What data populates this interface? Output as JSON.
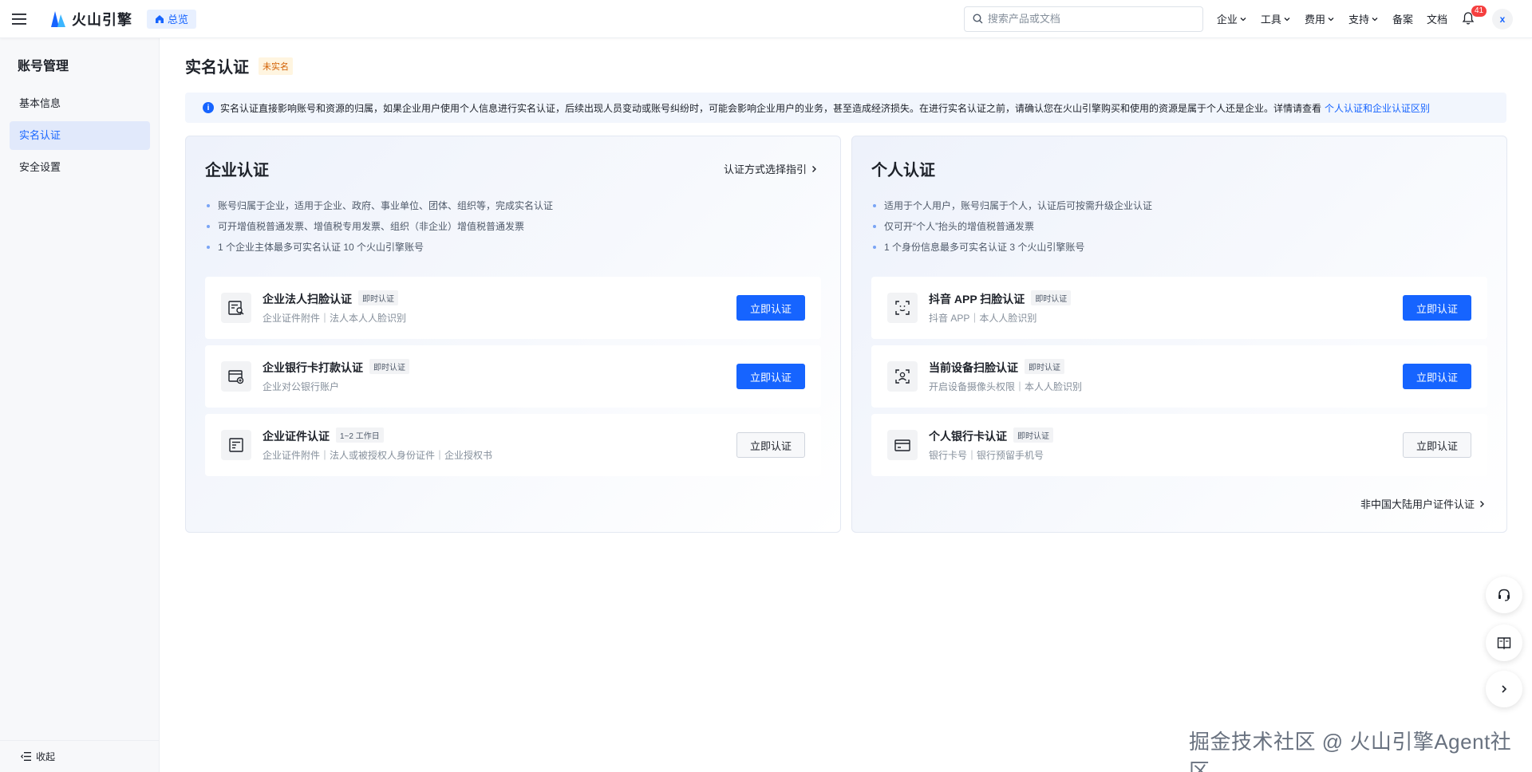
{
  "header": {
    "logo_text": "火山引擎",
    "home_label": "总览",
    "search_placeholder": "搜索产品或文档",
    "nav": [
      {
        "label": "企业",
        "dropdown": true
      },
      {
        "label": "工具",
        "dropdown": true
      },
      {
        "label": "费用",
        "dropdown": true
      },
      {
        "label": "支持",
        "dropdown": true
      },
      {
        "label": "备案",
        "dropdown": false
      },
      {
        "label": "文档",
        "dropdown": false
      }
    ],
    "notification_count": "41",
    "avatar_letter": "x"
  },
  "sidebar": {
    "title": "账号管理",
    "items": [
      {
        "label": "基本信息",
        "active": false
      },
      {
        "label": "实名认证",
        "active": true
      },
      {
        "label": "安全设置",
        "active": false
      }
    ],
    "collapse_label": "收起"
  },
  "main": {
    "title": "实名认证",
    "status_tag": "未实名",
    "notice_text": "实名认证直接影响账号和资源的归属，如果企业用户使用个人信息进行实名认证，后续出现人员变动或账号纠纷时，可能会影响企业用户的业务，甚至造成经济损失。在进行实名认证之前，请确认您在火山引擎购买和使用的资源是属于个人还是企业。详情请查看",
    "notice_link": "个人认证和企业认证区别",
    "enterprise": {
      "title": "企业认证",
      "guide_link": "认证方式选择指引",
      "bullets": [
        "账号归属于企业，适用于企业、政府、事业单位、团体、组织等，完成实名认证",
        "可开增值税普通发票、增值税专用发票、组织（非企业）增值税普通发票",
        "1 个企业主体最多可实名认证 10 个火山引擎账号"
      ],
      "methods": [
        {
          "title": "企业法人扫脸认证",
          "tag": "即时认证",
          "desc": "企业证件附件｜法人本人人脸识别",
          "button": "立即认证",
          "primary": true,
          "icon": "face-scan-document-icon"
        },
        {
          "title": "企业银行卡打款认证",
          "tag": "即时认证",
          "desc": "企业对公银行账户",
          "button": "立即认证",
          "primary": true,
          "icon": "bank-card-transfer-icon"
        },
        {
          "title": "企业证件认证",
          "tag": "1~2 工作日",
          "desc": "企业证件附件｜法人或被授权人身份证件｜企业授权书",
          "button": "立即认证",
          "primary": false,
          "icon": "certificate-document-icon"
        }
      ]
    },
    "personal": {
      "title": "个人认证",
      "bullets": [
        "适用于个人用户，账号归属于个人，认证后可按需升级企业认证",
        "仅可开“个人”抬头的增值税普通发票",
        "1 个身份信息最多可实名认证 3 个火山引擎账号"
      ],
      "methods": [
        {
          "title": "抖音 APP 扫脸认证",
          "tag": "即时认证",
          "desc": "抖音 APP｜本人人脸识别",
          "button": "立即认证",
          "primary": true,
          "icon": "qr-scan-icon"
        },
        {
          "title": "当前设备扫脸认证",
          "tag": "即时认证",
          "desc": "开启设备摄像头权限｜本人人脸识别",
          "button": "立即认证",
          "primary": true,
          "icon": "face-scan-icon"
        },
        {
          "title": "个人银行卡认证",
          "tag": "即时认证",
          "desc": "银行卡号｜银行预留手机号",
          "button": "立即认证",
          "primary": false,
          "icon": "bank-card-icon"
        }
      ],
      "foreign_link": "非中国大陆用户证件认证"
    }
  },
  "watermark": "掘金技术社区 @ 火山引擎Agent社区",
  "colors": {
    "primary": "#1664ff",
    "warning": "#d25f00",
    "danger": "#f53f3f"
  }
}
